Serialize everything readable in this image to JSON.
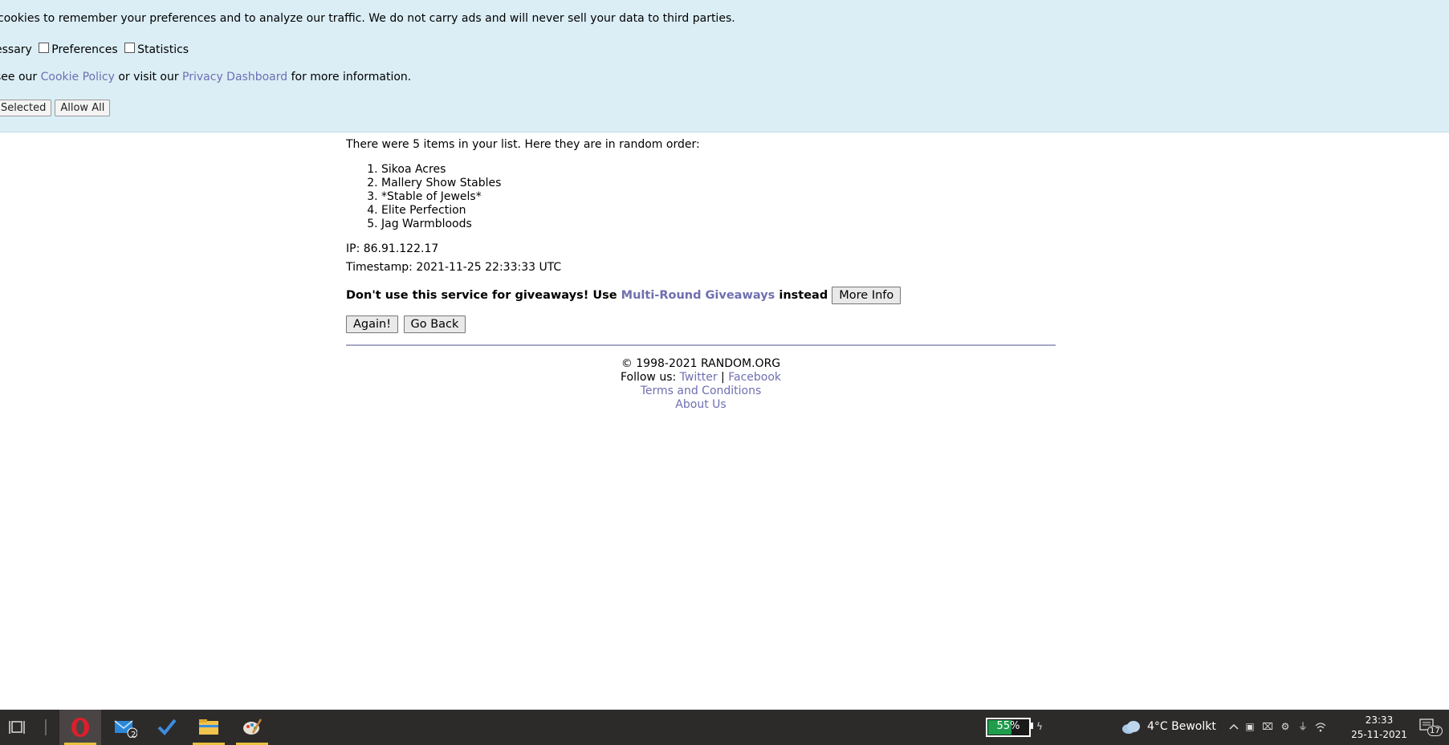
{
  "cookie_banner": {
    "line1": "cookies to remember your preferences and to analyze our traffic. We do not carry ads and will never sell your data to third parties.",
    "necessary_partial": "essary",
    "preferences_label": "Preferences",
    "statistics_label": "Statistics",
    "line3_prefix": "see our",
    "cookie_policy_link": "Cookie Policy",
    "line3_mid": "or visit our",
    "privacy_dashboard_link": "Privacy Dashboard",
    "line3_suffix": "for more information.",
    "allow_selected_partial": "Selected",
    "allow_all_label": "Allow All"
  },
  "result": {
    "intro": "There were 5 items in your list. Here they are in random order:",
    "items": [
      "Sikoa Acres",
      "Mallery Show Stables",
      "*Stable of Jewels*",
      "Elite Perfection",
      "Jag Warmbloods"
    ],
    "ip": "IP: 86.91.122.17",
    "timestamp": "Timestamp: 2021-11-25 22:33:33 UTC",
    "warning_prefix": "Don't use this service for giveaways! Use",
    "warning_link": "Multi-Round Giveaways",
    "warning_suffix": "instead",
    "more_info_label": "More Info",
    "again_label": "Again!",
    "go_back_label": "Go Back"
  },
  "footer": {
    "copyright": "© 1998-2021 RANDOM.ORG",
    "follow_prefix": "Follow us:",
    "twitter": "Twitter",
    "separator": "|",
    "facebook": "Facebook",
    "terms": "Terms and Conditions",
    "about": "About Us"
  },
  "taskbar": {
    "mail_badge": "2",
    "battery_percent": "55%",
    "battery_level": 0.55,
    "weather": "4°C  Bewolkt",
    "time": "23:33",
    "date": "25-11-2021",
    "notification_count": "17",
    "colors": {
      "background": "#2d2a2a",
      "battery_green": "#1f9d4c",
      "active_underline": "#e8c23c"
    }
  }
}
